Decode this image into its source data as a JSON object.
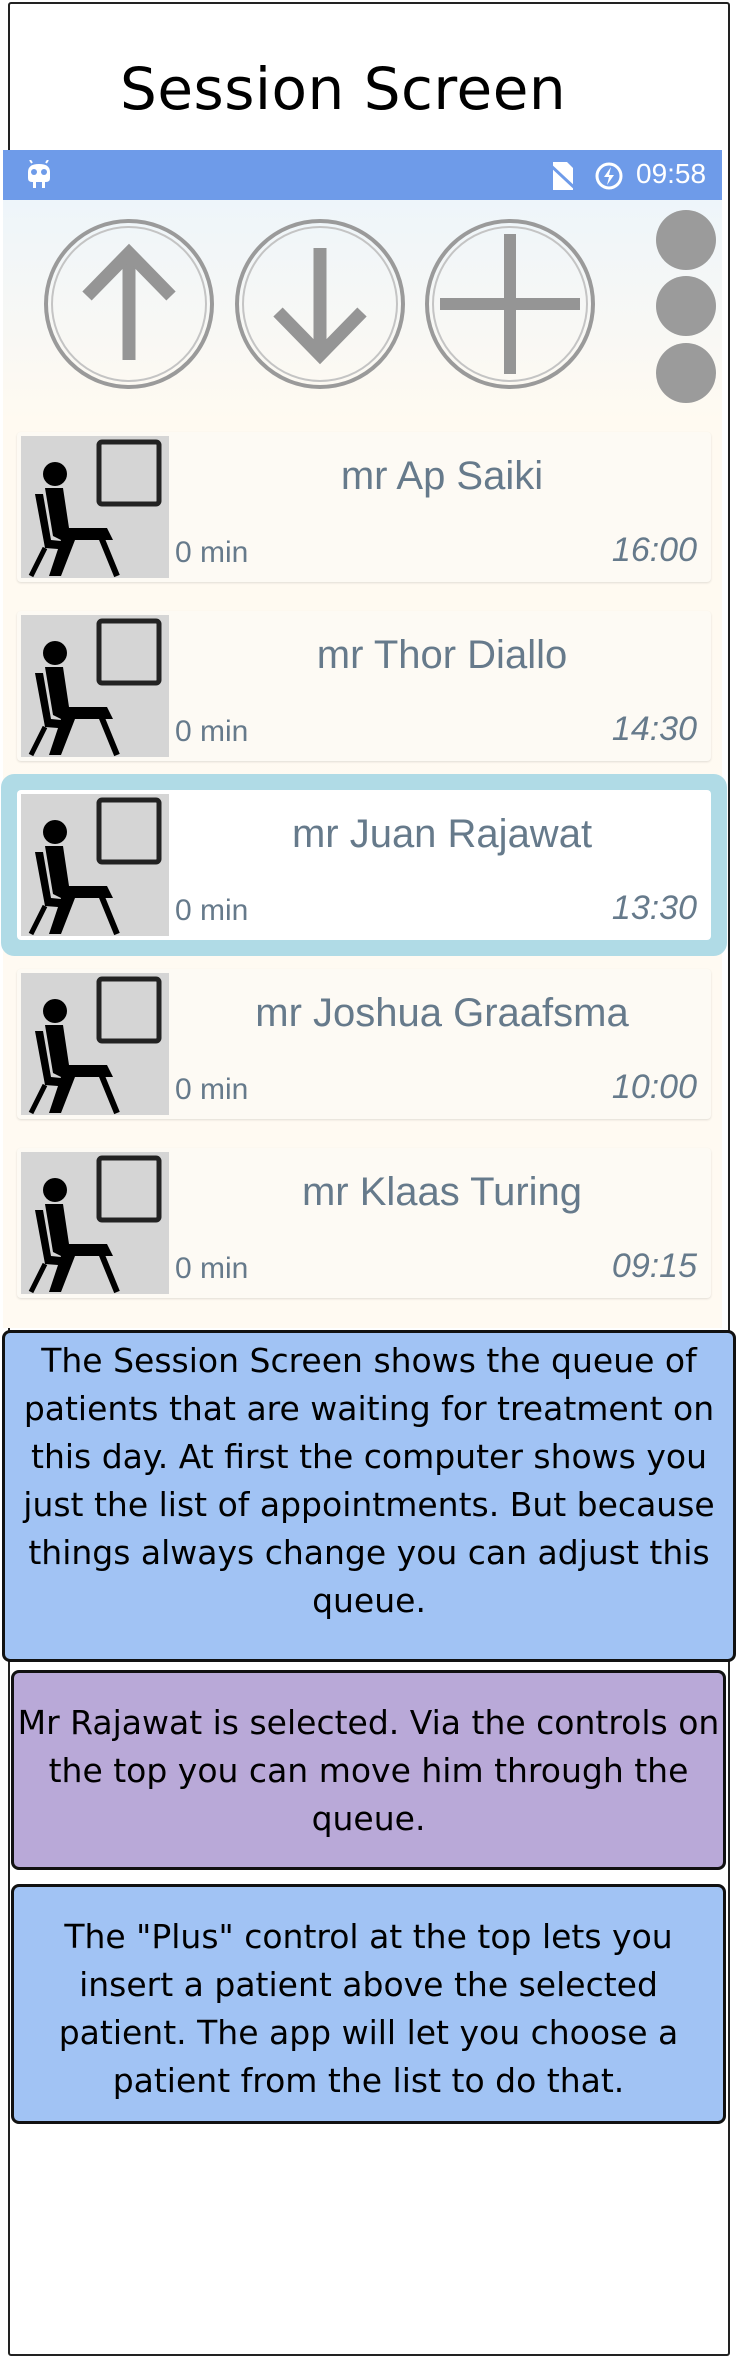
{
  "page": {
    "title": "Session Screen"
  },
  "status_bar": {
    "time": "09:58",
    "icons": [
      "android-icon",
      "no-sim-icon",
      "data-saver-icon"
    ]
  },
  "toolbar": {
    "controls": [
      "move-up-button",
      "move-down-button",
      "add-button"
    ],
    "overflow_menu": "overflow-menu-icon"
  },
  "queue": [
    {
      "name": "mr Ap Saiki",
      "duration": "0 min",
      "time": "16:00",
      "selected": false
    },
    {
      "name": "mr Thor Diallo",
      "duration": "0 min",
      "time": "14:30",
      "selected": false
    },
    {
      "name": "mr Juan Rajawat",
      "duration": "0 min",
      "time": "13:30",
      "selected": true
    },
    {
      "name": "mr Joshua Graafsma",
      "duration": "0 min",
      "time": "10:00",
      "selected": false
    },
    {
      "name": "mr Klaas Turing",
      "duration": "0 min",
      "time": "09:15",
      "selected": false
    }
  ],
  "notes": {
    "note1": "The Session Screen shows the queue of patients that are waiting for treatment on this day. At first the computer shows you just the list of appointments. But because things always change you can adjust this queue.",
    "note2": "Mr Rajawat is selected. Via the controls on the top you can move him through the queue.",
    "note3": "The \"Plus\" control at the top lets you insert a patient above the selected patient. The app will let you choose a patient from the list to do that."
  },
  "colors": {
    "status_bar": "#6e9be9",
    "selected_highlight": "#b0dbe6",
    "note_blue": "#a1c3f4",
    "note_purple": "#b9a9d8",
    "list_text": "#667a8b"
  }
}
